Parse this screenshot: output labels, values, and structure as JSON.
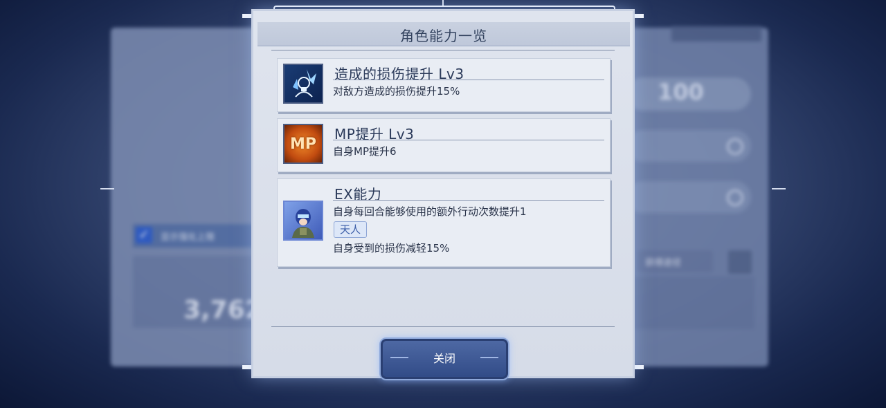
{
  "dialog": {
    "title": "角色能力一览",
    "abilities": [
      {
        "title": "造成的损伤提升 Lv3",
        "description": "对敌方造成的损伤提升15%",
        "icon": "damage-up-icon"
      },
      {
        "title": "MP提升 Lv3",
        "description": "自身MP提升6",
        "icon": "mp-up-icon",
        "icon_text": "MP"
      },
      {
        "title": "EX能力",
        "description": "自身每回合能够使用的额外行动次数提升1",
        "tag": "天人",
        "tag_description": "自身受到的损伤减轻15%",
        "icon": "character-portrait-icon"
      }
    ],
    "close_label": "关闭"
  },
  "background": {
    "stat_value": "100",
    "toggle_label": "显示强化上限",
    "power_value": "3,762",
    "right_button_label": "获得途径"
  },
  "colors": {
    "dialog_bg": "#dfe4ee",
    "title_text": "#33435f",
    "button_bg": "#304a86",
    "accent": "#3c5ea8"
  }
}
